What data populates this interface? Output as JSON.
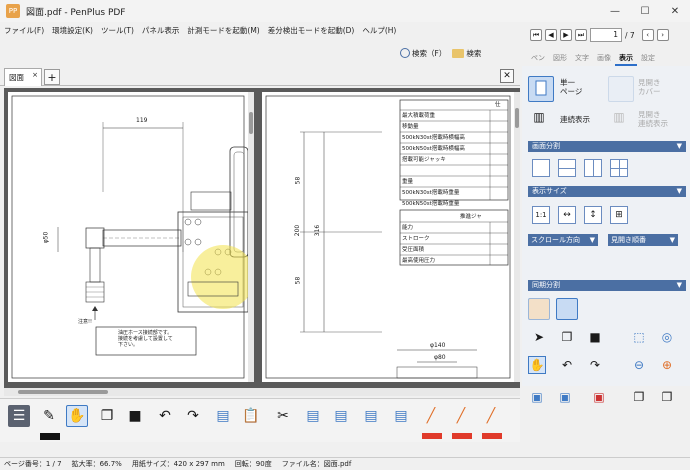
{
  "window": {
    "title": "図面.pdf - PenPlus PDF",
    "app_icon": "PP",
    "minimize": "—",
    "maximize": "☐",
    "close": "✕"
  },
  "menu": [
    "ファイル(F)",
    "環境設定(K)",
    "ツール(T)",
    "パネル表示",
    "計測モードを起動(M)",
    "差分検出モードを起動(D)",
    "ヘルプ(H)"
  ],
  "search": {
    "search1": "検索（F）",
    "search2": "検索"
  },
  "tabs": [
    {
      "label": "図面",
      "close": "×"
    }
  ],
  "nav": {
    "page_value": "1",
    "page_total": "/ 7"
  },
  "ribbon_tabs": [
    "ペン",
    "図形",
    "文字",
    "画像",
    "表示",
    "設定"
  ],
  "ribbon_active": "表示",
  "panel": {
    "single_page": "単一\nページ",
    "facing_cover": "見開き\nカバー",
    "continuous": "連続表示",
    "continuous_facing": "見開き\n連続表示",
    "split_section": "画面分割",
    "size_section": "表示サイズ",
    "scroll_direction": "スクロール方向",
    "facing_order": "見開き順番",
    "sync_section": "同期分割"
  },
  "drawing": {
    "dim_119": "119",
    "dim_50": "φ50",
    "dim_58a": "58",
    "dim_58b": "58",
    "dim_200": "200",
    "dim_316": "316",
    "dim_140": "φ140",
    "dim_80": "φ80",
    "note_label": "注意!!",
    "note_text": "油圧ホース接続部です。\n接続を考慮して設置して\n下さい。",
    "spec_header": "仕",
    "spec_rows": [
      "最大積載荷重",
      "移動量",
      "500kN30st搭載時横幅高",
      "500kN50st搭載時横幅高",
      "搭載可能ジャッキ",
      "",
      "重量",
      "500kN30st搭載時重量",
      "500kN50st搭載時重量"
    ],
    "spec2_header": "推進ジャ",
    "spec2_rows": [
      "能力",
      "ストローク",
      "受圧面積",
      "最高使用圧力"
    ]
  },
  "status": {
    "page": "ページ番号：1 / 7",
    "zoom": "拡大率：66.7%",
    "paper": "用紙サイズ：420 x 297 mm",
    "rotation": "回転：90度",
    "filename": "ファイル名：図面.pdf"
  },
  "colors": {
    "accent": "#3f7ac4",
    "pen_red": "#e03a2a",
    "highlight": "#f2e14a"
  }
}
